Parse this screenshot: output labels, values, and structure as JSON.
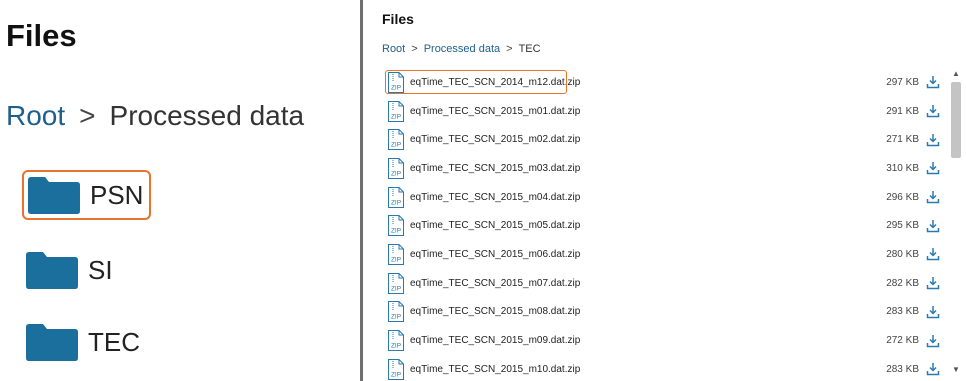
{
  "left": {
    "title": "Files",
    "breadcrumb": {
      "root": "Root",
      "separator": ">",
      "current": "Processed data"
    },
    "folders": [
      {
        "name": "PSN",
        "highlighted": true
      },
      {
        "name": "SI",
        "highlighted": false
      },
      {
        "name": "TEC",
        "highlighted": false
      }
    ]
  },
  "right": {
    "title": "Files",
    "breadcrumb": {
      "root": "Root",
      "separator": ">",
      "middle": "Processed data",
      "separator2": ">",
      "current": "TEC"
    },
    "files": [
      {
        "name": "eqTime_TEC_SCN_2014_m12.dat.zip",
        "size": "297 KB",
        "highlighted": true
      },
      {
        "name": "eqTime_TEC_SCN_2015_m01.dat.zip",
        "size": "291 KB",
        "highlighted": false
      },
      {
        "name": "eqTime_TEC_SCN_2015_m02.dat.zip",
        "size": "271 KB",
        "highlighted": false
      },
      {
        "name": "eqTime_TEC_SCN_2015_m03.dat.zip",
        "size": "310 KB",
        "highlighted": false
      },
      {
        "name": "eqTime_TEC_SCN_2015_m04.dat.zip",
        "size": "296 KB",
        "highlighted": false
      },
      {
        "name": "eqTime_TEC_SCN_2015_m05.dat.zip",
        "size": "295 KB",
        "highlighted": false
      },
      {
        "name": "eqTime_TEC_SCN_2015_m06.dat.zip",
        "size": "280 KB",
        "highlighted": false
      },
      {
        "name": "eqTime_TEC_SCN_2015_m07.dat.zip",
        "size": "282 KB",
        "highlighted": false
      },
      {
        "name": "eqTime_TEC_SCN_2015_m08.dat.zip",
        "size": "283 KB",
        "highlighted": false
      },
      {
        "name": "eqTime_TEC_SCN_2015_m09.dat.zip",
        "size": "272 KB",
        "highlighted": false
      },
      {
        "name": "eqTime_TEC_SCN_2015_m10.dat.zip",
        "size": "283 KB",
        "highlighted": false
      }
    ]
  },
  "icons": {
    "folder": "folder-icon",
    "zip": "zip-file-icon",
    "zip_label": "ZIP",
    "download": "download-icon"
  },
  "colors": {
    "highlight": "#e8732c",
    "folder": "#1b6f9c",
    "link": "#1f5f8b",
    "icon_blue": "#2a7ab0"
  }
}
